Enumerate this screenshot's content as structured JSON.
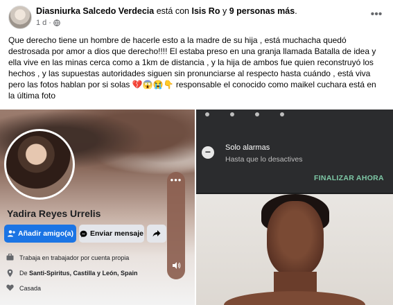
{
  "post": {
    "author": "Diasniurka Salcedo Verdecia",
    "with_text": "está con",
    "tagged": "Isis Ro",
    "and_text": "y",
    "others": "9 personas más",
    "period": ".",
    "time": "1 d",
    "dot": "·",
    "more_icon": "more-options-icon",
    "close_icon": "close-icon",
    "caption": "Que derecho tiene un hombre de hacerle esto a la madre de su hija , está muchacha quedó destrosada por amor a dios que derecho!!!! El  estaba preso en una granja llamada Batalla de idea y ella vive en las minas cerca como a 1km de distancia , y la hija de ambos fue quien reconstruyó los hechos , y las supuestas autoridades siguen sin pronunciarse al respecto hasta cuándo , está viva pero las fotos hablan por si solas 💔😱😭👇 responsable el conocido como maikel cuchara está en la última foto"
  },
  "left_photo": {
    "profile_name": "Yadira Reyes Urrelis",
    "add_friend": "Añadir amigo(a)",
    "send_message": "Enviar mensaje",
    "info": [
      {
        "icon": "briefcase-icon",
        "text": "Trabaja en trabajador por cuenta propia",
        "bold": ""
      },
      {
        "icon": "location-pin-icon",
        "text": "De ",
        "bold": "Santi-Spiritus, Castilla y León, Spain"
      },
      {
        "icon": "heart-icon",
        "text": "Casada",
        "bold": ""
      }
    ],
    "overlay_dots": "•••"
  },
  "right_photo": {
    "notif_title": "Solo alarmas",
    "notif_sub": "Hasta que lo desactives",
    "notif_action": "FINALIZAR AHORA"
  },
  "colors": {
    "link": "#1b74e4",
    "muted": "#65676b",
    "dark_panel": "#2b2c2e",
    "action_green": "#7ec8a6"
  }
}
